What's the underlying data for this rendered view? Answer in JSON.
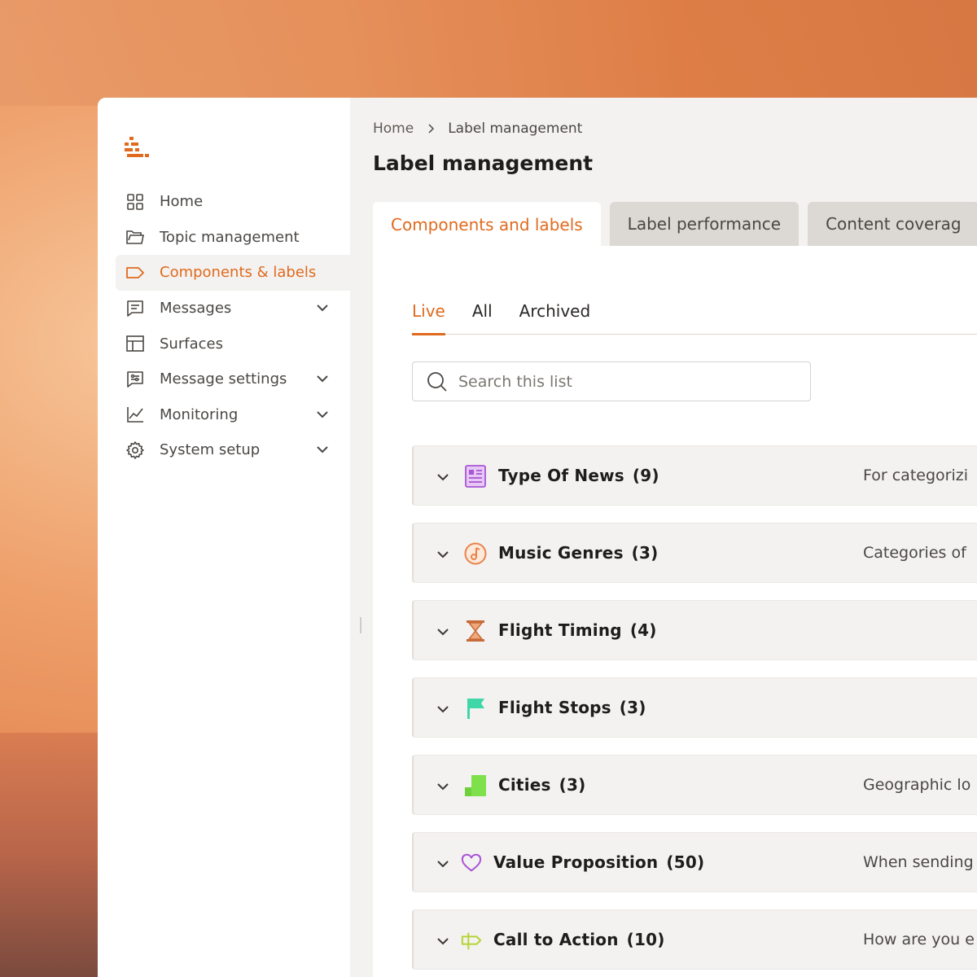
{
  "sidebar": {
    "items": [
      {
        "label": "Home",
        "icon": "grid-icon",
        "expandable": false,
        "active": false
      },
      {
        "label": "Topic management",
        "icon": "folder-icon",
        "expandable": false,
        "active": false
      },
      {
        "label": "Components & labels",
        "icon": "tag-icon",
        "expandable": false,
        "active": true
      },
      {
        "label": "Messages",
        "icon": "message-icon",
        "expandable": true,
        "active": false
      },
      {
        "label": "Surfaces",
        "icon": "layout-icon",
        "expandable": false,
        "active": false
      },
      {
        "label": "Message settings",
        "icon": "message-settings-icon",
        "expandable": true,
        "active": false
      },
      {
        "label": "Monitoring",
        "icon": "chart-line-icon",
        "expandable": true,
        "active": false
      },
      {
        "label": "System setup",
        "icon": "gear-icon",
        "expandable": true,
        "active": false
      }
    ]
  },
  "breadcrumb": {
    "home": "Home",
    "current": "Label management"
  },
  "page": {
    "title": "Label management"
  },
  "tabs": [
    {
      "label": "Components and labels",
      "active": true
    },
    {
      "label": "Label performance",
      "active": false
    },
    {
      "label": "Content coverag",
      "active": false
    }
  ],
  "subtabs": [
    {
      "label": "Live",
      "active": true
    },
    {
      "label": "All",
      "active": false
    },
    {
      "label": "Archived",
      "active": false
    }
  ],
  "search": {
    "placeholder": "Search this list",
    "value": ""
  },
  "groups": [
    {
      "name": "Type Of News",
      "count": "(9)",
      "icon": "newspaper-icon",
      "icon_color": "#a855d6",
      "description": "For categorizi"
    },
    {
      "name": "Music Genres",
      "count": "(3)",
      "icon": "music-note-icon",
      "icon_color": "#e8834a",
      "description": "Categories of"
    },
    {
      "name": "Flight Timing",
      "count": "(4)",
      "icon": "hourglass-icon",
      "icon_color": "#e8834a",
      "description": ""
    },
    {
      "name": "Flight Stops",
      "count": "(3)",
      "icon": "flag-icon",
      "icon_color": "#3fd6a8",
      "description": ""
    },
    {
      "name": "Cities",
      "count": "(3)",
      "icon": "building-icon",
      "icon_color": "#7ee04a",
      "description": "Geographic lo"
    },
    {
      "name": "Value Proposition",
      "count": "(50)",
      "icon": "heart-icon",
      "icon_color": "#a855d6",
      "description": "When sending"
    },
    {
      "name": "Call to Action",
      "count": "(10)",
      "icon": "signpost-icon",
      "icon_color": "#b5d43a",
      "description": "How are you e"
    }
  ],
  "colors": {
    "accent": "#e06a1e",
    "background": "#f3f2f0",
    "sidebar": "#ffffff"
  }
}
